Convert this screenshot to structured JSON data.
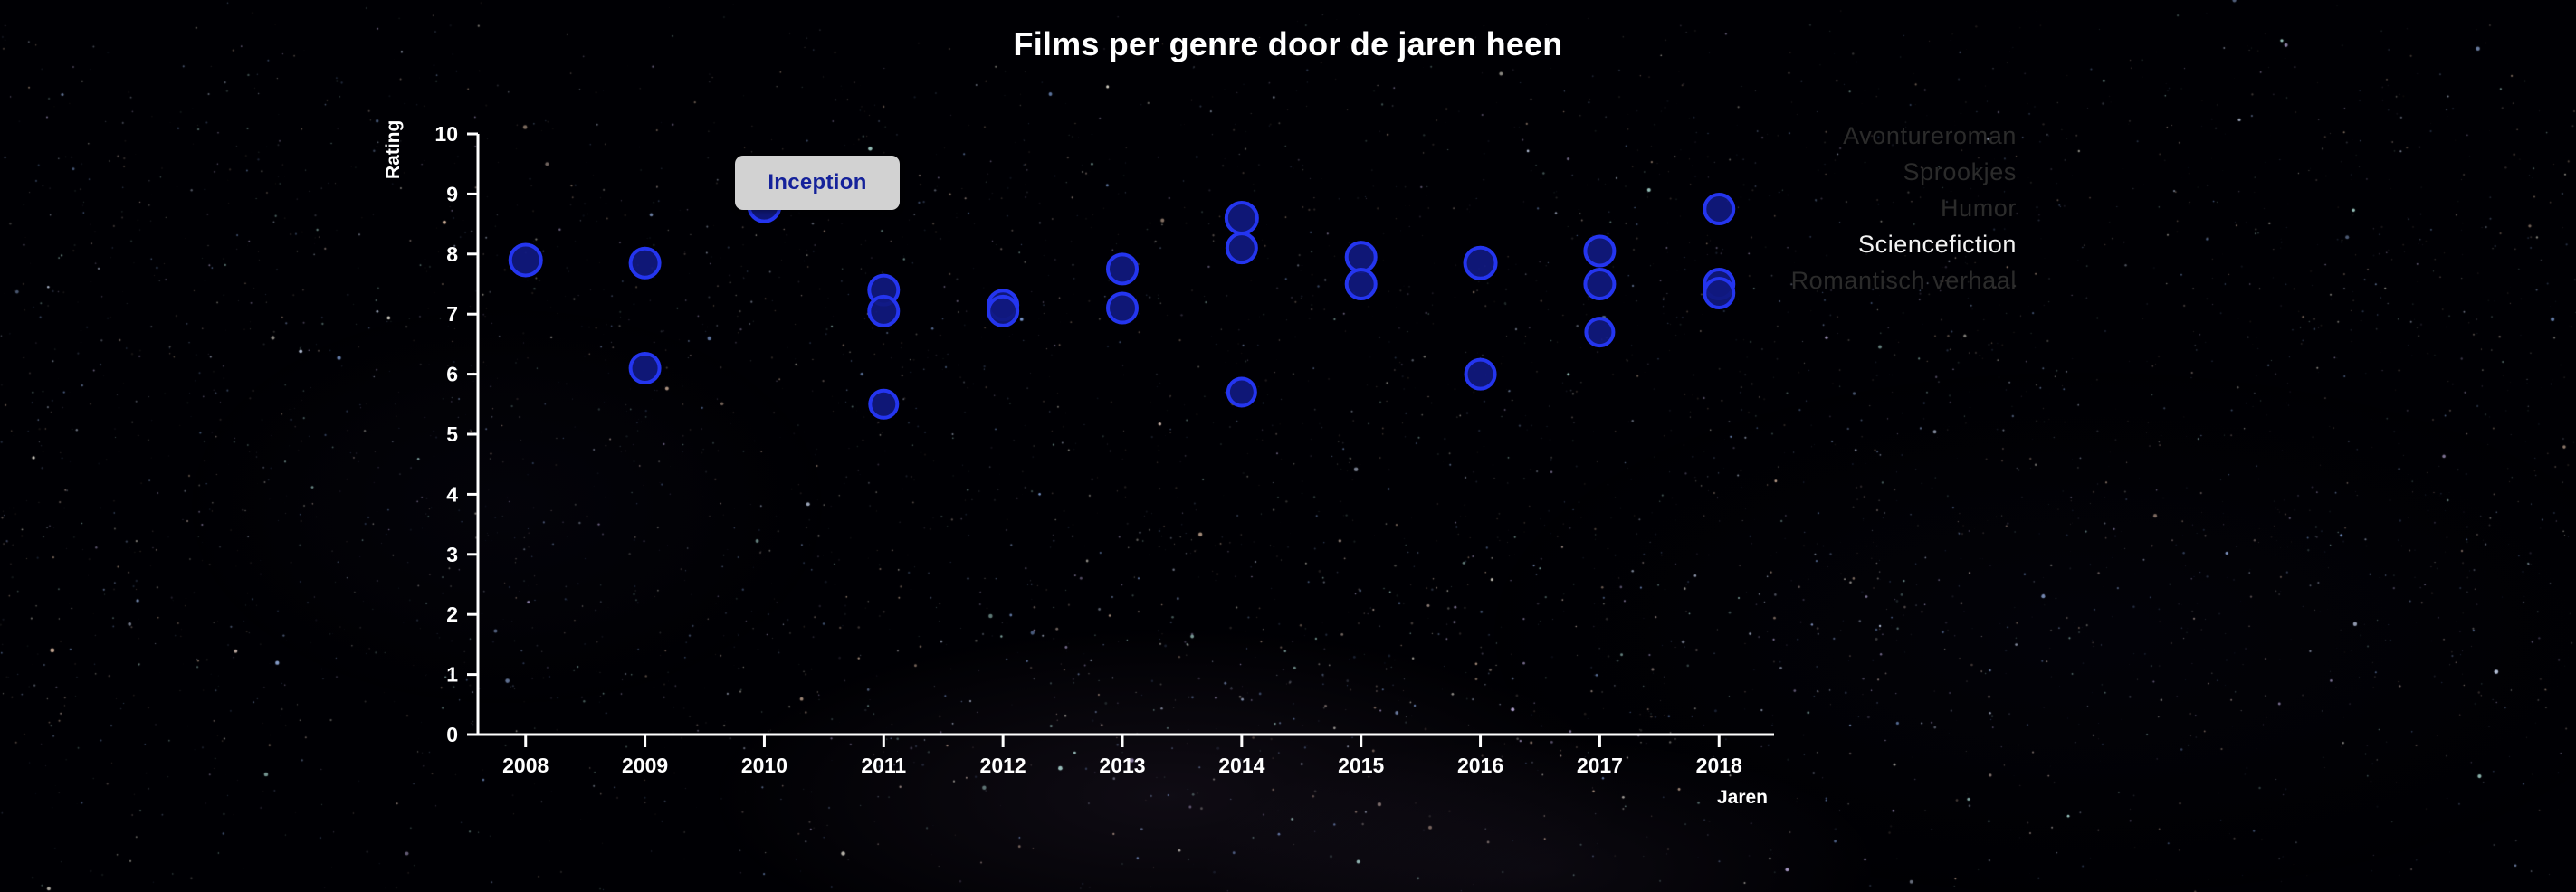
{
  "page": {
    "title": "Films per genre door de jaren heen",
    "background": "#000004"
  },
  "tooltip": {
    "label": "Inception",
    "background": "#d2d2d2",
    "text_color": "#15229b"
  },
  "legend": {
    "position": "right",
    "items": [
      {
        "label": "Avontureroman",
        "active": false,
        "color": "#2b2b2b"
      },
      {
        "label": "Sprookjes",
        "active": false,
        "color": "#2b2b2b"
      },
      {
        "label": "Humor",
        "active": false,
        "color": "#2b2b2b"
      },
      {
        "label": "Sciencefiction",
        "active": true,
        "color": "#f2f2f2"
      },
      {
        "label": "Romantisch verhaal",
        "active": false,
        "color": "#2b2b2b"
      }
    ]
  },
  "chart_data": {
    "type": "scatter",
    "title": "Films per genre door de jaren heen",
    "xlabel": "Jaren",
    "ylabel": "Rating",
    "xlim": [
      2007.6,
      2018.4
    ],
    "ylim": [
      0,
      10
    ],
    "grid": false,
    "legend_position": "right",
    "bubble_fill": "#10197f",
    "bubble_stroke": "#2435ef",
    "x_ticks": [
      2008,
      2009,
      2010,
      2011,
      2012,
      2013,
      2014,
      2015,
      2016,
      2017,
      2018
    ],
    "y_ticks": [
      0,
      1,
      2,
      3,
      4,
      5,
      6,
      7,
      8,
      9,
      10
    ],
    "series": [
      {
        "name": "Sciencefiction",
        "points": [
          {
            "x": 2008,
            "y": 7.9,
            "r": 17,
            "label": ""
          },
          {
            "x": 2009,
            "y": 7.85,
            "r": 16,
            "label": ""
          },
          {
            "x": 2009,
            "y": 6.1,
            "r": 16,
            "label": ""
          },
          {
            "x": 2010,
            "y": 8.8,
            "r": 17,
            "label": "Inception"
          },
          {
            "x": 2011,
            "y": 7.4,
            "r": 16,
            "label": ""
          },
          {
            "x": 2011,
            "y": 7.05,
            "r": 16,
            "label": ""
          },
          {
            "x": 2011,
            "y": 5.5,
            "r": 15,
            "label": ""
          },
          {
            "x": 2012,
            "y": 7.15,
            "r": 16,
            "label": ""
          },
          {
            "x": 2012,
            "y": 7.05,
            "r": 16,
            "label": ""
          },
          {
            "x": 2013,
            "y": 7.75,
            "r": 16,
            "label": ""
          },
          {
            "x": 2013,
            "y": 7.1,
            "r": 16,
            "label": ""
          },
          {
            "x": 2014,
            "y": 8.6,
            "r": 17,
            "label": ""
          },
          {
            "x": 2014,
            "y": 8.1,
            "r": 16,
            "label": ""
          },
          {
            "x": 2014,
            "y": 5.7,
            "r": 15,
            "label": ""
          },
          {
            "x": 2015,
            "y": 7.95,
            "r": 16,
            "label": ""
          },
          {
            "x": 2015,
            "y": 7.5,
            "r": 16,
            "label": ""
          },
          {
            "x": 2016,
            "y": 7.85,
            "r": 17,
            "label": ""
          },
          {
            "x": 2016,
            "y": 6.0,
            "r": 16,
            "label": ""
          },
          {
            "x": 2017,
            "y": 8.05,
            "r": 16,
            "label": ""
          },
          {
            "x": 2017,
            "y": 7.5,
            "r": 16,
            "label": ""
          },
          {
            "x": 2017,
            "y": 6.7,
            "r": 15,
            "label": ""
          },
          {
            "x": 2018,
            "y": 8.75,
            "r": 16,
            "label": ""
          },
          {
            "x": 2018,
            "y": 7.5,
            "r": 16,
            "label": ""
          },
          {
            "x": 2018,
            "y": 7.35,
            "r": 16,
            "label": ""
          }
        ]
      }
    ]
  }
}
